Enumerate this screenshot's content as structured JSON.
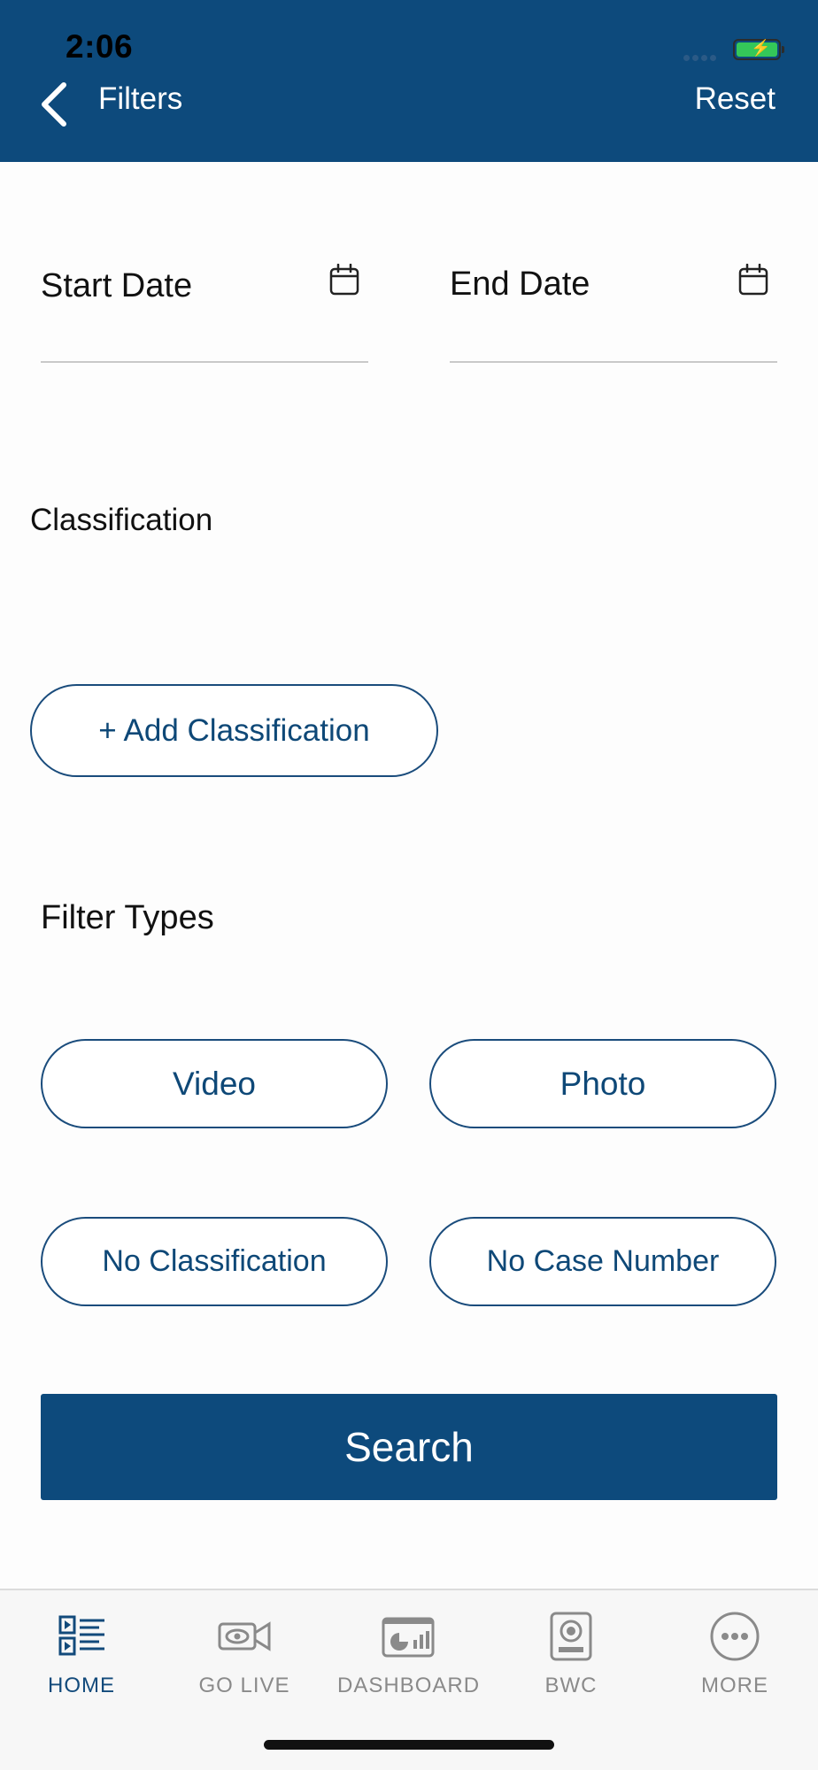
{
  "status_bar": {
    "time": "2:06"
  },
  "header": {
    "title": "Filters",
    "reset_label": "Reset"
  },
  "dates": {
    "start_label": "Start Date",
    "end_label": "End Date"
  },
  "classification": {
    "label": "Classification",
    "add_label": "+ Add Classification"
  },
  "filter_types": {
    "label": "Filter Types",
    "options": [
      "Video",
      "Photo",
      "No Classification",
      "No Case Number"
    ]
  },
  "search_label": "Search",
  "tabbar": {
    "tabs": [
      {
        "label": "HOME",
        "icon": "home-list-icon",
        "active": true
      },
      {
        "label": "GO LIVE",
        "icon": "camera-icon",
        "active": false
      },
      {
        "label": "DASHBOARD",
        "icon": "dashboard-icon",
        "active": false
      },
      {
        "label": "BWC",
        "icon": "body-camera-icon",
        "active": false
      },
      {
        "label": "MORE",
        "icon": "more-icon",
        "active": false
      }
    ]
  },
  "colors": {
    "primary": "#0d4a7c",
    "tab_active": "#124a7b",
    "tab_inactive": "#8a8a8a",
    "battery": "#34c759"
  }
}
